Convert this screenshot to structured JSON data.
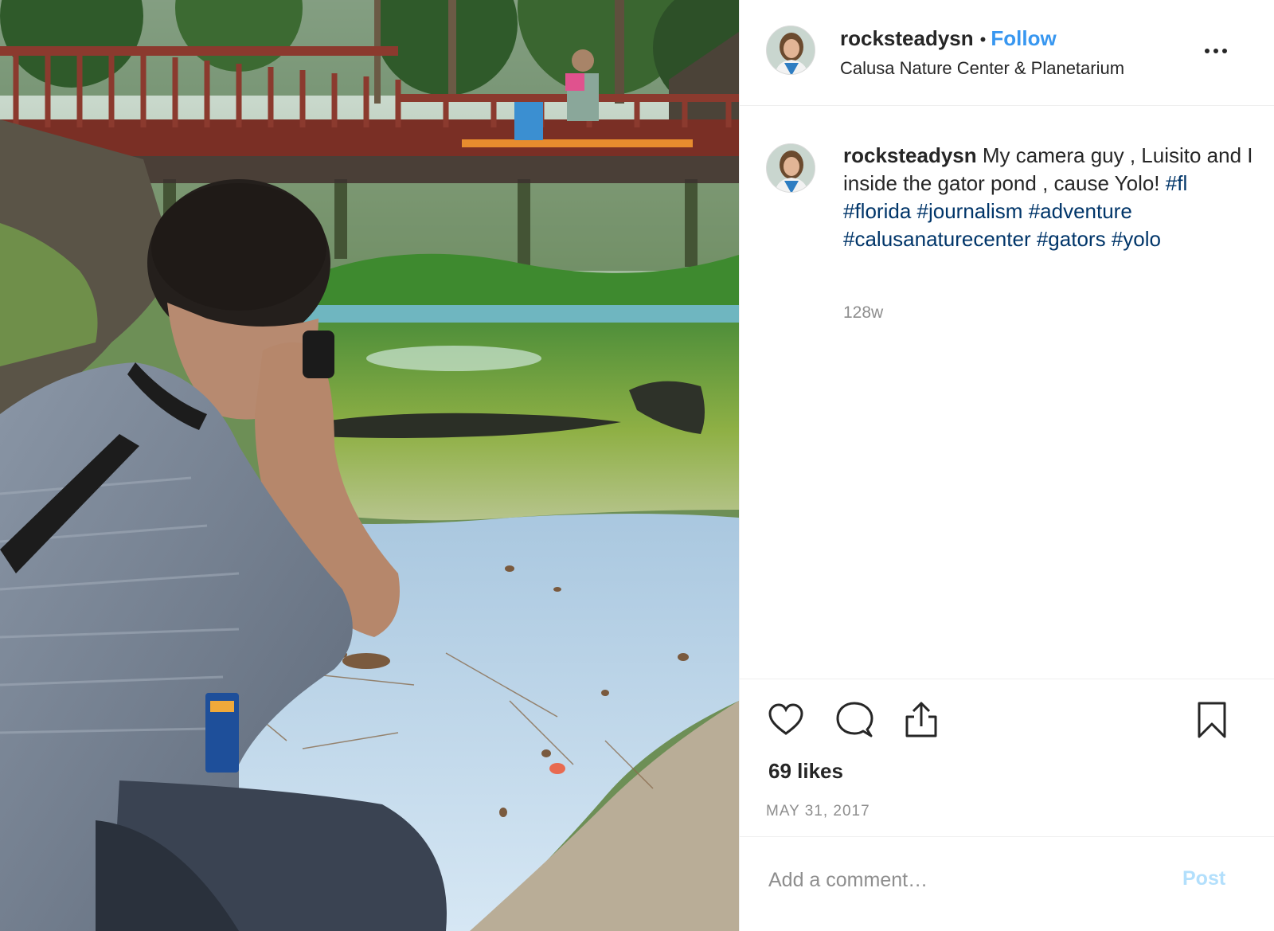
{
  "post": {
    "image_icon": "photo-of-photographer-at-gator-pond"
  },
  "header": {
    "username": "rocksteadysn",
    "separator": "•",
    "follow_label": "Follow",
    "location": "Calusa Nature Center & Planetarium",
    "more_icon": "more-options-icon"
  },
  "caption": {
    "username": "rocksteadysn",
    "text": "My camera guy , Luisito and I inside the gator pond , cause Yolo!",
    "hashtags": [
      "#fl",
      "#florida",
      "#journalism",
      "#adventure",
      "#calusanaturecenter",
      "#gators",
      "#yolo"
    ],
    "age": "128w"
  },
  "actions": {
    "like_icon": "heart-icon",
    "comment_icon": "comment-icon",
    "share_icon": "share-icon",
    "save_icon": "bookmark-icon",
    "likes": "69 likes",
    "date": "MAY 31, 2017"
  },
  "comment_box": {
    "placeholder": "Add a comment…",
    "post_label": "Post"
  },
  "colors": {
    "link_blue": "#3897f0",
    "hashtag": "#003569",
    "muted": "#8e8e8e",
    "post_disabled": "#b2dffc"
  }
}
